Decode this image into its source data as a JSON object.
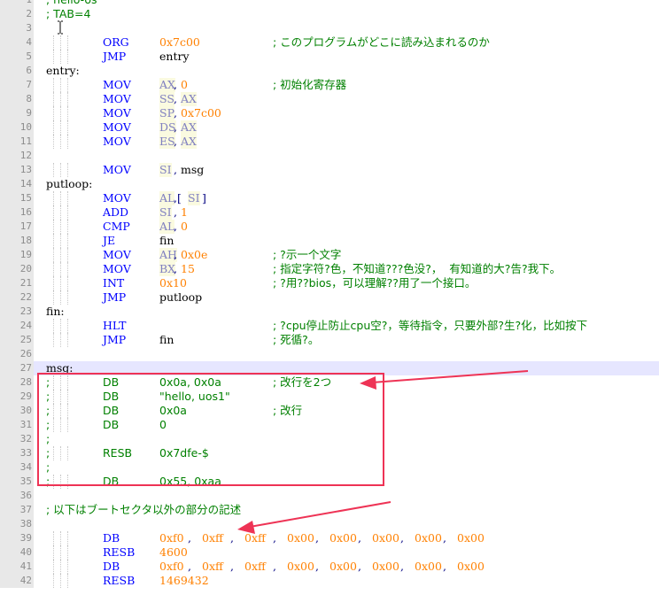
{
  "editor": {
    "current_line": 27,
    "lines": [
      {
        "n": "1",
        "tokens": [
          {
            "c": "c-cmt",
            "t": "; hello-os"
          }
        ]
      },
      {
        "n": "2",
        "tokens": [
          {
            "c": "c-cmt",
            "t": "; TAB=4"
          }
        ]
      },
      {
        "n": "3",
        "tokens": []
      },
      {
        "n": "4",
        "tokens": [
          {
            "c": "c-kw",
            "t": "ORG",
            "col": 8
          },
          {
            "c": "c-num",
            "t": "0x7c00",
            "col": 16
          },
          {
            "c": "c-cmt",
            "t": "; このプログラムがどこに読み込まれるのか",
            "col": 32
          }
        ]
      },
      {
        "n": "5",
        "tokens": [
          {
            "c": "c-kw",
            "t": "JMP",
            "col": 8
          },
          {
            "c": "c-txt",
            "t": "entry",
            "col": 16
          }
        ]
      },
      {
        "n": "6",
        "tokens": [
          {
            "c": "c-lbl",
            "t": "entry:",
            "col": 0
          }
        ]
      },
      {
        "n": "7",
        "tokens": [
          {
            "c": "c-kw",
            "t": "MOV",
            "col": 8
          },
          {
            "c": "c-reg",
            "t": "AX",
            "col": 16
          },
          {
            "c": "c-op",
            "t": ",",
            "col": 18
          },
          {
            "c": "c-num",
            "t": "0",
            "col": 19
          },
          {
            "c": "c-cmt",
            "t": "; 初始化寄存器",
            "col": 32
          }
        ]
      },
      {
        "n": "8",
        "tokens": [
          {
            "c": "c-kw",
            "t": "MOV",
            "col": 8
          },
          {
            "c": "c-reg",
            "t": "SS",
            "col": 16
          },
          {
            "c": "c-op",
            "t": ",",
            "col": 18
          },
          {
            "c": "c-reg",
            "t": "AX",
            "col": 19
          }
        ]
      },
      {
        "n": "9",
        "tokens": [
          {
            "c": "c-kw",
            "t": "MOV",
            "col": 8
          },
          {
            "c": "c-reg",
            "t": "SP",
            "col": 16
          },
          {
            "c": "c-op",
            "t": ",",
            "col": 18
          },
          {
            "c": "c-num",
            "t": "0x7c00",
            "col": 19
          }
        ]
      },
      {
        "n": "10",
        "tokens": [
          {
            "c": "c-kw",
            "t": "MOV",
            "col": 8
          },
          {
            "c": "c-reg",
            "t": "DS",
            "col": 16
          },
          {
            "c": "c-op",
            "t": ",",
            "col": 18
          },
          {
            "c": "c-reg",
            "t": "AX",
            "col": 19
          }
        ]
      },
      {
        "n": "11",
        "tokens": [
          {
            "c": "c-kw",
            "t": "MOV",
            "col": 8
          },
          {
            "c": "c-reg",
            "t": "ES",
            "col": 16
          },
          {
            "c": "c-op",
            "t": ",",
            "col": 18
          },
          {
            "c": "c-reg",
            "t": "AX",
            "col": 19
          }
        ]
      },
      {
        "n": "12",
        "tokens": []
      },
      {
        "n": "13",
        "tokens": [
          {
            "c": "c-kw",
            "t": "MOV",
            "col": 8
          },
          {
            "c": "c-reg",
            "t": "SI",
            "col": 16
          },
          {
            "c": "c-op",
            "t": ",",
            "col": 18
          },
          {
            "c": "c-txt",
            "t": "msg",
            "col": 19
          }
        ]
      },
      {
        "n": "14",
        "tokens": [
          {
            "c": "c-lbl",
            "t": "putloop:",
            "col": 0
          }
        ]
      },
      {
        "n": "15",
        "tokens": [
          {
            "c": "c-kw",
            "t": "MOV",
            "col": 8
          },
          {
            "c": "c-reg",
            "t": "AL",
            "col": 16
          },
          {
            "c": "c-op",
            "t": ",[",
            "col": 18
          },
          {
            "c": "c-reg",
            "t": "SI",
            "col": 20
          },
          {
            "c": "c-op",
            "t": "]",
            "col": 22
          }
        ]
      },
      {
        "n": "16",
        "tokens": [
          {
            "c": "c-kw",
            "t": "ADD",
            "col": 8
          },
          {
            "c": "c-reg",
            "t": "SI",
            "col": 16
          },
          {
            "c": "c-op",
            "t": ",",
            "col": 18
          },
          {
            "c": "c-num",
            "t": "1",
            "col": 19
          }
        ]
      },
      {
        "n": "17",
        "tokens": [
          {
            "c": "c-kw",
            "t": "CMP",
            "col": 8
          },
          {
            "c": "c-reg",
            "t": "AL",
            "col": 16
          },
          {
            "c": "c-op",
            "t": ",",
            "col": 18
          },
          {
            "c": "c-num",
            "t": "0",
            "col": 19
          }
        ]
      },
      {
        "n": "18",
        "tokens": [
          {
            "c": "c-kw",
            "t": "JE",
            "col": 8
          },
          {
            "c": "c-txt",
            "t": "fin",
            "col": 16
          }
        ]
      },
      {
        "n": "19",
        "tokens": [
          {
            "c": "c-kw",
            "t": "MOV",
            "col": 8
          },
          {
            "c": "c-reg",
            "t": "AH",
            "col": 16
          },
          {
            "c": "c-op",
            "t": ",",
            "col": 18
          },
          {
            "c": "c-num",
            "t": "0x0e",
            "col": 19
          },
          {
            "c": "c-cmt",
            "t": "; ?示一个文字",
            "col": 32
          }
        ]
      },
      {
        "n": "20",
        "tokens": [
          {
            "c": "c-kw",
            "t": "MOV",
            "col": 8
          },
          {
            "c": "c-reg",
            "t": "BX",
            "col": 16
          },
          {
            "c": "c-op",
            "t": ",",
            "col": 18
          },
          {
            "c": "c-num",
            "t": "15",
            "col": 19
          },
          {
            "c": "c-cmt",
            "t": "; 指定字符?色，不知道???色没?，  有知道的大?告?我下。",
            "col": 32
          }
        ]
      },
      {
        "n": "21",
        "tokens": [
          {
            "c": "c-kw",
            "t": "INT",
            "col": 8
          },
          {
            "c": "c-num",
            "t": "0x10",
            "col": 16
          },
          {
            "c": "c-cmt",
            "t": "; ?用??bios，可以理解??用了一个接口。",
            "col": 32
          }
        ]
      },
      {
        "n": "22",
        "tokens": [
          {
            "c": "c-kw",
            "t": "JMP",
            "col": 8
          },
          {
            "c": "c-txt",
            "t": "putloop",
            "col": 16
          }
        ]
      },
      {
        "n": "23",
        "tokens": [
          {
            "c": "c-lbl",
            "t": "fin:",
            "col": 0
          }
        ]
      },
      {
        "n": "24",
        "tokens": [
          {
            "c": "c-kw",
            "t": "HLT",
            "col": 8
          },
          {
            "c": "c-cmt",
            "t": "; ?cpu停止防止cpu空?，等待指令，只要外部?生?化，比如按下",
            "col": 32
          }
        ]
      },
      {
        "n": "25",
        "tokens": [
          {
            "c": "c-kw",
            "t": "JMP",
            "col": 8
          },
          {
            "c": "c-txt",
            "t": "fin",
            "col": 16
          },
          {
            "c": "c-cmt",
            "t": "; 死循?。",
            "col": 32
          }
        ]
      },
      {
        "n": "26",
        "tokens": []
      },
      {
        "n": "27",
        "tokens": [
          {
            "c": "c-lbl",
            "t": "msg:",
            "col": 0
          }
        ]
      },
      {
        "n": "28",
        "tokens": [
          {
            "c": "c-cmt",
            "t": ";",
            "col": 0
          },
          {
            "c": "c-cmt",
            "t": "DB",
            "col": 8
          },
          {
            "c": "c-cmt",
            "t": "0x0a, 0x0a",
            "col": 16
          },
          {
            "c": "c-cmt",
            "t": "; 改行を2つ",
            "col": 32
          }
        ]
      },
      {
        "n": "29",
        "tokens": [
          {
            "c": "c-cmt",
            "t": ";",
            "col": 0
          },
          {
            "c": "c-cmt",
            "t": "DB",
            "col": 8
          },
          {
            "c": "c-cmt",
            "t": "\"hello, uos1\"",
            "col": 16
          }
        ]
      },
      {
        "n": "30",
        "tokens": [
          {
            "c": "c-cmt",
            "t": ";",
            "col": 0
          },
          {
            "c": "c-cmt",
            "t": "DB",
            "col": 8
          },
          {
            "c": "c-cmt",
            "t": "0x0a",
            "col": 16
          },
          {
            "c": "c-cmt",
            "t": "; 改行",
            "col": 32
          }
        ]
      },
      {
        "n": "31",
        "tokens": [
          {
            "c": "c-cmt",
            "t": ";",
            "col": 0
          },
          {
            "c": "c-cmt",
            "t": "DB",
            "col": 8
          },
          {
            "c": "c-cmt",
            "t": "0",
            "col": 16
          }
        ]
      },
      {
        "n": "32",
        "tokens": [
          {
            "c": "c-cmt",
            "t": ";",
            "col": 0
          }
        ]
      },
      {
        "n": "33",
        "tokens": [
          {
            "c": "c-cmt",
            "t": ";",
            "col": 0
          },
          {
            "c": "c-cmt",
            "t": "RESB",
            "col": 8
          },
          {
            "c": "c-cmt",
            "t": "0x7dfe-$",
            "col": 16
          }
        ]
      },
      {
        "n": "34",
        "tokens": [
          {
            "c": "c-cmt",
            "t": ";",
            "col": 0
          }
        ]
      },
      {
        "n": "35",
        "tokens": [
          {
            "c": "c-cmt",
            "t": ";",
            "col": 0
          },
          {
            "c": "c-cmt",
            "t": "DB",
            "col": 8
          },
          {
            "c": "c-cmt",
            "t": "0x55, 0xaa",
            "col": 16
          }
        ]
      },
      {
        "n": "36",
        "tokens": []
      },
      {
        "n": "37",
        "tokens": [
          {
            "c": "c-cmt",
            "t": "; 以下はブートセクタ以外の部分の記述",
            "col": 0
          }
        ]
      },
      {
        "n": "38",
        "tokens": []
      },
      {
        "n": "39",
        "tokens": [
          {
            "c": "c-kw",
            "t": "DB",
            "col": 8
          },
          {
            "c": "c-num",
            "t": "0xf0",
            "col": 16
          },
          {
            "c": "c-op",
            "t": ", ",
            "col": 20
          },
          {
            "c": "c-num",
            "t": "0xff",
            "col": 22
          },
          {
            "c": "c-op",
            "t": ", ",
            "col": 26
          },
          {
            "c": "c-num",
            "t": "0xff",
            "col": 28
          },
          {
            "c": "c-op",
            "t": ", ",
            "col": 32
          },
          {
            "c": "c-num",
            "t": "0x00",
            "col": 34
          },
          {
            "c": "c-op",
            "t": ", ",
            "col": 38
          },
          {
            "c": "c-num",
            "t": "0x00",
            "col": 40
          },
          {
            "c": "c-op",
            "t": ", ",
            "col": 44
          },
          {
            "c": "c-num",
            "t": "0x00",
            "col": 46
          },
          {
            "c": "c-op",
            "t": ", ",
            "col": 50
          },
          {
            "c": "c-num",
            "t": "0x00",
            "col": 52
          },
          {
            "c": "c-op",
            "t": ", ",
            "col": 56
          },
          {
            "c": "c-num",
            "t": "0x00",
            "col": 58
          }
        ]
      },
      {
        "n": "40",
        "tokens": [
          {
            "c": "c-kw",
            "t": "RESB",
            "col": 8
          },
          {
            "c": "c-num",
            "t": "4600",
            "col": 16
          }
        ]
      },
      {
        "n": "41",
        "tokens": [
          {
            "c": "c-kw",
            "t": "DB",
            "col": 8
          },
          {
            "c": "c-num",
            "t": "0xf0",
            "col": 16
          },
          {
            "c": "c-op",
            "t": ", ",
            "col": 20
          },
          {
            "c": "c-num",
            "t": "0xff",
            "col": 22
          },
          {
            "c": "c-op",
            "t": ", ",
            "col": 26
          },
          {
            "c": "c-num",
            "t": "0xff",
            "col": 28
          },
          {
            "c": "c-op",
            "t": ", ",
            "col": 32
          },
          {
            "c": "c-num",
            "t": "0x00",
            "col": 34
          },
          {
            "c": "c-op",
            "t": ", ",
            "col": 38
          },
          {
            "c": "c-num",
            "t": "0x00",
            "col": 40
          },
          {
            "c": "c-op",
            "t": ", ",
            "col": 44
          },
          {
            "c": "c-num",
            "t": "0x00",
            "col": 46
          },
          {
            "c": "c-op",
            "t": ", ",
            "col": 50
          },
          {
            "c": "c-num",
            "t": "0x00",
            "col": 52
          },
          {
            "c": "c-op",
            "t": ", ",
            "col": 56
          },
          {
            "c": "c-num",
            "t": "0x00",
            "col": 58
          }
        ]
      },
      {
        "n": "42",
        "tokens": [
          {
            "c": "c-kw",
            "t": "RESB",
            "col": 8
          },
          {
            "c": "c-num",
            "t": "1469432",
            "col": 16
          }
        ]
      }
    ]
  },
  "annotation": {
    "box_color": "#ee3355",
    "arrow_color": "#ee3355"
  }
}
